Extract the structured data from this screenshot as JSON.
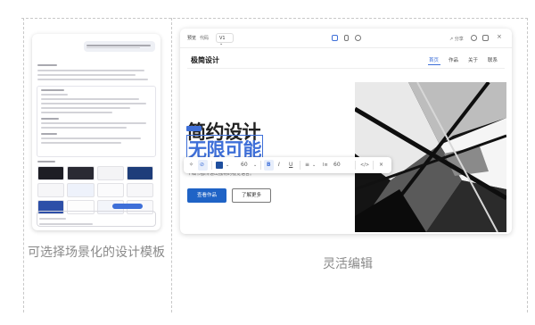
{
  "captions": {
    "left": "可选择场景化的设计模板",
    "right": "灵活编辑"
  },
  "editor": {
    "tabs": [
      "预览",
      "代码"
    ],
    "version": "V1",
    "share_label": "分享",
    "site_title": "极简设计",
    "nav": [
      "首页",
      "作品",
      "关于",
      "联系"
    ],
    "hero_line1": "简约设计",
    "hero_line2": "无限可能",
    "subtitle": "个细节都传递出独特的视觉语言。",
    "primary_button": "查看作品",
    "secondary_button": "了解更多"
  },
  "toolbar": {
    "font_size": "60",
    "bold": "B",
    "italic": "I",
    "underline": "U",
    "line_height": "60",
    "code": "</>",
    "close": "×",
    "dropdown": "⌄"
  },
  "colors": {
    "accent": "#3e6fd8",
    "primary_button": "#1f63c6",
    "text_color_swatch": "#1f4f9e"
  },
  "icons": [
    "sparkle-icon",
    "paint-icon",
    "align-icon",
    "text-size-icon",
    "code-icon",
    "close-icon",
    "desktop-icon",
    "mobile-icon",
    "settings-icon",
    "share-icon",
    "refresh-icon",
    "external-link-icon"
  ]
}
